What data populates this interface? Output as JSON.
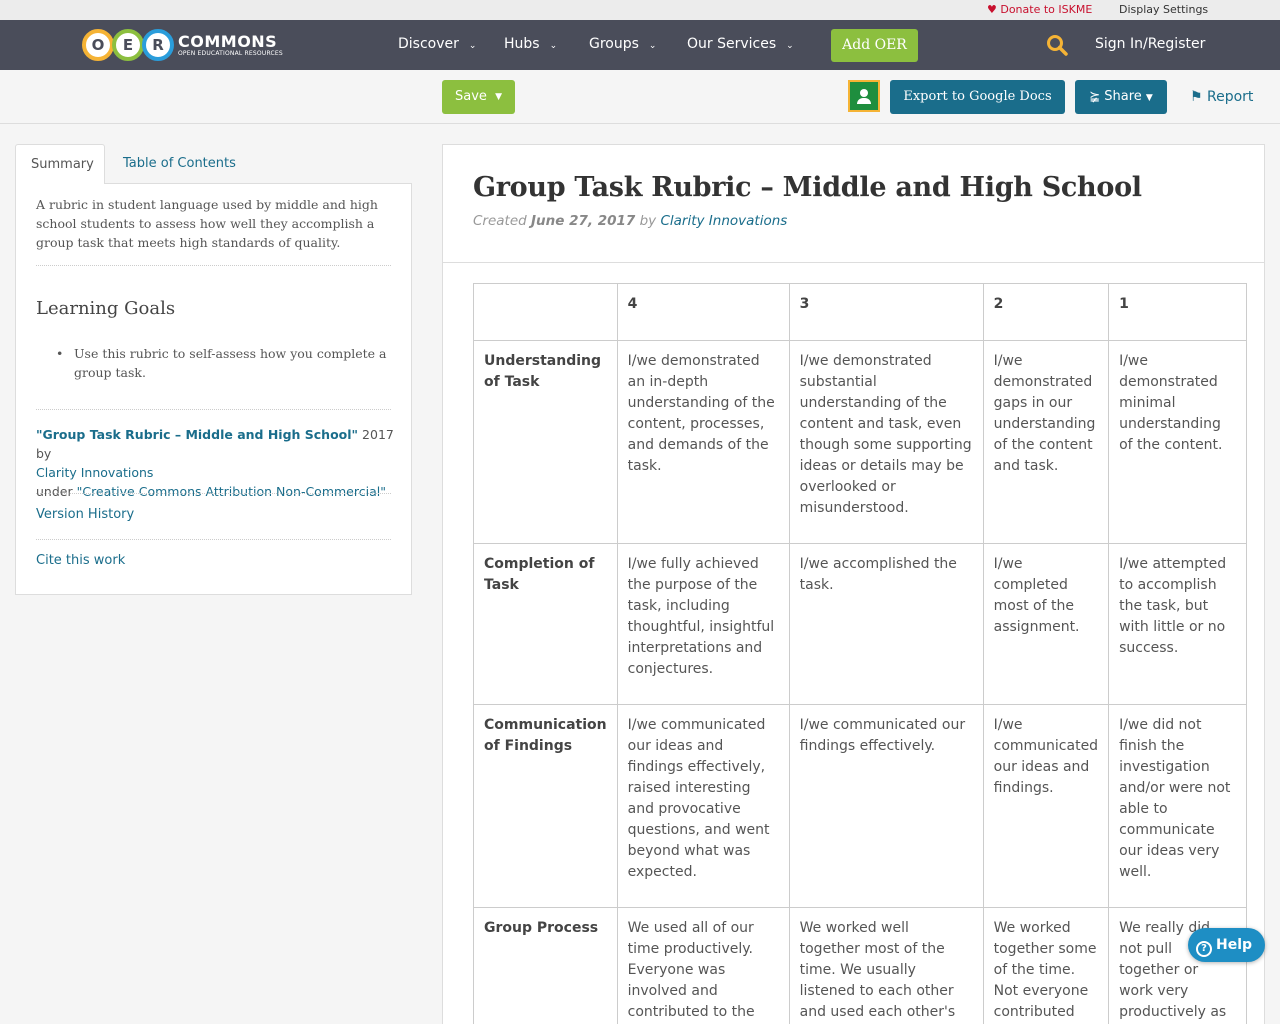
{
  "utility": {
    "donate": "Donate to ISKME",
    "display_settings": "Display Settings"
  },
  "header": {
    "logo_letters": [
      "O",
      "E",
      "R"
    ],
    "logo_main": "COMMONS",
    "logo_sub": "OPEN EDUCATIONAL RESOURCES",
    "nav": [
      "Discover",
      "Hubs",
      "Groups",
      "Our Services"
    ],
    "add_oer": "Add OER",
    "signin": "Sign In/Register"
  },
  "toolbar": {
    "save": "Save",
    "export": "Export to Google Docs",
    "share": "Share",
    "report": "Report"
  },
  "sidebar": {
    "tabs": [
      "Summary",
      "Table of Contents"
    ],
    "summary": "A rubric in student language used by middle and high school students to assess how well they accomplish a group task that meets high standards of quality.",
    "learning_goals_title": "Learning Goals",
    "learning_goals": [
      "Use this rubric to self-assess how you complete a group task."
    ],
    "attribution": {
      "title": "\"Group Task Rubric – Middle and High School\"",
      "year_by": " 2017 by",
      "author": "Clarity Innovations",
      "under": "under ",
      "license": "\"Creative Commons Attribution Non-Commercial\""
    },
    "version_history": "Version History",
    "cite": "Cite this work"
  },
  "document": {
    "title": "Group Task Rubric – Middle and High School",
    "created_label": "Created ",
    "date": "June 27, 2017",
    "by_label": " by ",
    "author": "Clarity Innovations"
  },
  "rubric": {
    "headers": [
      "",
      "4",
      "3",
      "2",
      "1"
    ],
    "rows": [
      {
        "criterion": "Understanding of Task",
        "cells": [
          "I/we demonstrated an in-depth understanding of the content, processes, and demands of the task.",
          "I/we demonstrated substantial understanding of the content and task, even though some supporting ideas or details may be overlooked or misunderstood.",
          "I/we demonstrated gaps in our understanding of the content and task.",
          "I/we demonstrated minimal understanding of the content."
        ]
      },
      {
        "criterion": "Completion of Task",
        "cells": [
          "I/we fully achieved the purpose of the task, including thoughtful, insightful interpretations and conjectures.",
          "I/we accomplished the task.",
          "I/we completed most of the assignment.",
          "I/we attempted to accomplish the task, but with little or no success."
        ]
      },
      {
        "criterion": "Communication of Findings",
        "cells": [
          "I/we communicated our ideas and findings effectively, raised interesting and provocative questions, and went beyond what was expected.",
          "I/we communicated our findings effectively.",
          "I/we communicated our ideas and findings.",
          "I/we did not finish the investigation and/or were not able to communicate our ideas very well."
        ]
      },
      {
        "criterion": "Group Process",
        "cells": [
          "We used all of our time productively. Everyone was involved and contributed to the group process and",
          "We worked well together most of the time. We usually listened to each other and used each other's ideas.",
          "We worked together some of the time. Not everyone contributed",
          "We really did not pull together or work very productively as a group. Not"
        ]
      }
    ]
  },
  "help": "Help"
}
